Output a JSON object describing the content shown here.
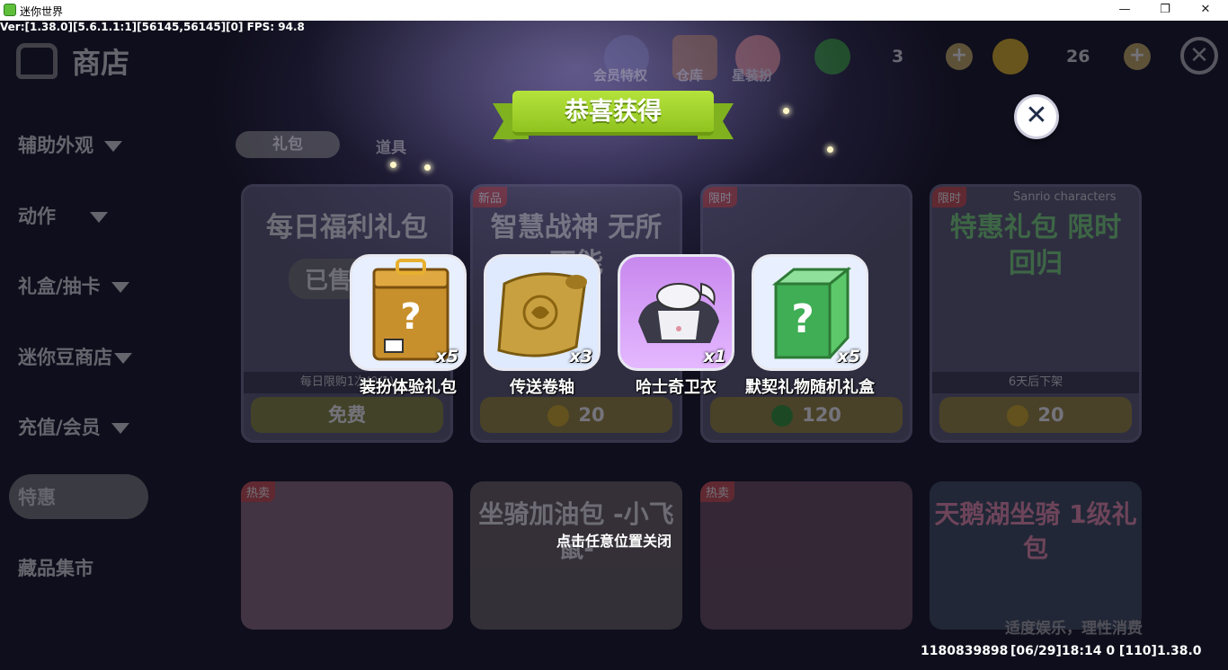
{
  "window": {
    "title": "迷你世界",
    "minimize_glyph": "—",
    "restore_glyph": "❐",
    "close_glyph": "✕"
  },
  "version_text": "Ver:[1.38.0][5.6.1.1:1][56145,56145][0] FPS: 94.8",
  "shop": {
    "title": "商店",
    "sidebar": [
      "辅助外观",
      "动作",
      "礼盒/抽卡",
      "迷你豆商店",
      "充值/会员",
      "特惠",
      "藏品集市"
    ],
    "tabs": [
      "礼包",
      "道具"
    ],
    "top_icons": [
      "会员特权",
      "仓库",
      "星装扮"
    ],
    "currency": {
      "green": "3",
      "gold": "26"
    },
    "plus": "+",
    "close_glyph": "✕",
    "cards": [
      {
        "tag": "",
        "art": "每日福利礼包",
        "badge": "已售罄",
        "strip": "每日限购1次(0/1)",
        "price": "免费"
      },
      {
        "tag": "新品",
        "art": "智慧战神 无所不能",
        "strip": "",
        "price": "20"
      },
      {
        "tag": "限时",
        "art": "",
        "strip": "",
        "price": "120"
      },
      {
        "tag": "限时",
        "art": "特惠礼包 限时回归",
        "subtitle": "Sanrio characters",
        "strip": "6天后下架",
        "price": "20"
      }
    ],
    "cards_row2": [
      {
        "tag": "热卖",
        "art": ""
      },
      {
        "tag": "",
        "art": "坐骑加油包 -小飞鼠-"
      },
      {
        "tag": "热卖",
        "art": ""
      },
      {
        "tag": "",
        "art": "天鹅湖坐骑 1级礼包"
      }
    ],
    "slogan": "适度娱乐，理性消费"
  },
  "popup": {
    "title": "恭喜获得",
    "close_glyph": "✕",
    "rewards": [
      {
        "name": "装扮体验礼包",
        "qty": "x5",
        "icon": "gift-box-icon",
        "bg": "#e8f0ff"
      },
      {
        "name": "传送卷轴",
        "qty": "x3",
        "icon": "scroll-icon",
        "bg": "#dfeaff"
      },
      {
        "name": "哈士奇卫衣",
        "qty": "x1",
        "icon": "hoodie-icon",
        "bg": "#d6a6f4"
      },
      {
        "name": "默契礼物随机礼盒",
        "qty": "x5",
        "icon": "mystery-box-icon",
        "bg": "#e8f0ff"
      }
    ],
    "hint": "点击任意位置关闭"
  },
  "footer": {
    "user_id": "1180839898",
    "time_version": "[06/29]18:14 0  [110]1.38.0"
  },
  "colors": {
    "accent_green": "#9ccf28",
    "close_navy": "#1e2a48"
  }
}
